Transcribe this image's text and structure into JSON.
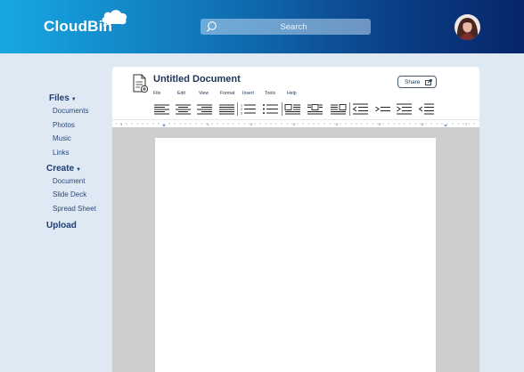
{
  "header": {
    "logo": "CloudBin",
    "search": {
      "placeholder": "Search",
      "value": ""
    },
    "avatar": "user-avatar"
  },
  "sidebar": {
    "files": {
      "label": "Files",
      "items": [
        "Documents",
        "Photos",
        "Music",
        "Links"
      ]
    },
    "create": {
      "label": "Create",
      "items": [
        "Document",
        "Slide Deck",
        "Spread Sheet"
      ]
    },
    "upload": {
      "label": "Upload"
    }
  },
  "document": {
    "title": "Untitled Document",
    "menu": [
      "File",
      "Edit",
      "View",
      "Format",
      "Insert",
      "Tools",
      "Help"
    ],
    "share_label": "Share",
    "toolbar": [
      "align-left-icon",
      "align-center-icon",
      "align-right-icon",
      "align-justify-icon",
      "numbered-list-icon",
      "bullet-list-icon",
      "image-left-wrap-icon",
      "image-center-wrap-icon",
      "image-right-wrap-icon",
      "outdent-icon",
      "indent-icon",
      "indent-first-line-icon",
      "outdent-first-line-icon"
    ],
    "ruler_numbers": [
      "1",
      "1",
      "2",
      "3",
      "4",
      "5",
      "6",
      "7"
    ]
  },
  "colors": {
    "header_start": "#17a8e3",
    "header_end": "#06256a",
    "background": "#dfe9f4",
    "nav_text": "#1d3d70",
    "canvas": "#cecece"
  }
}
